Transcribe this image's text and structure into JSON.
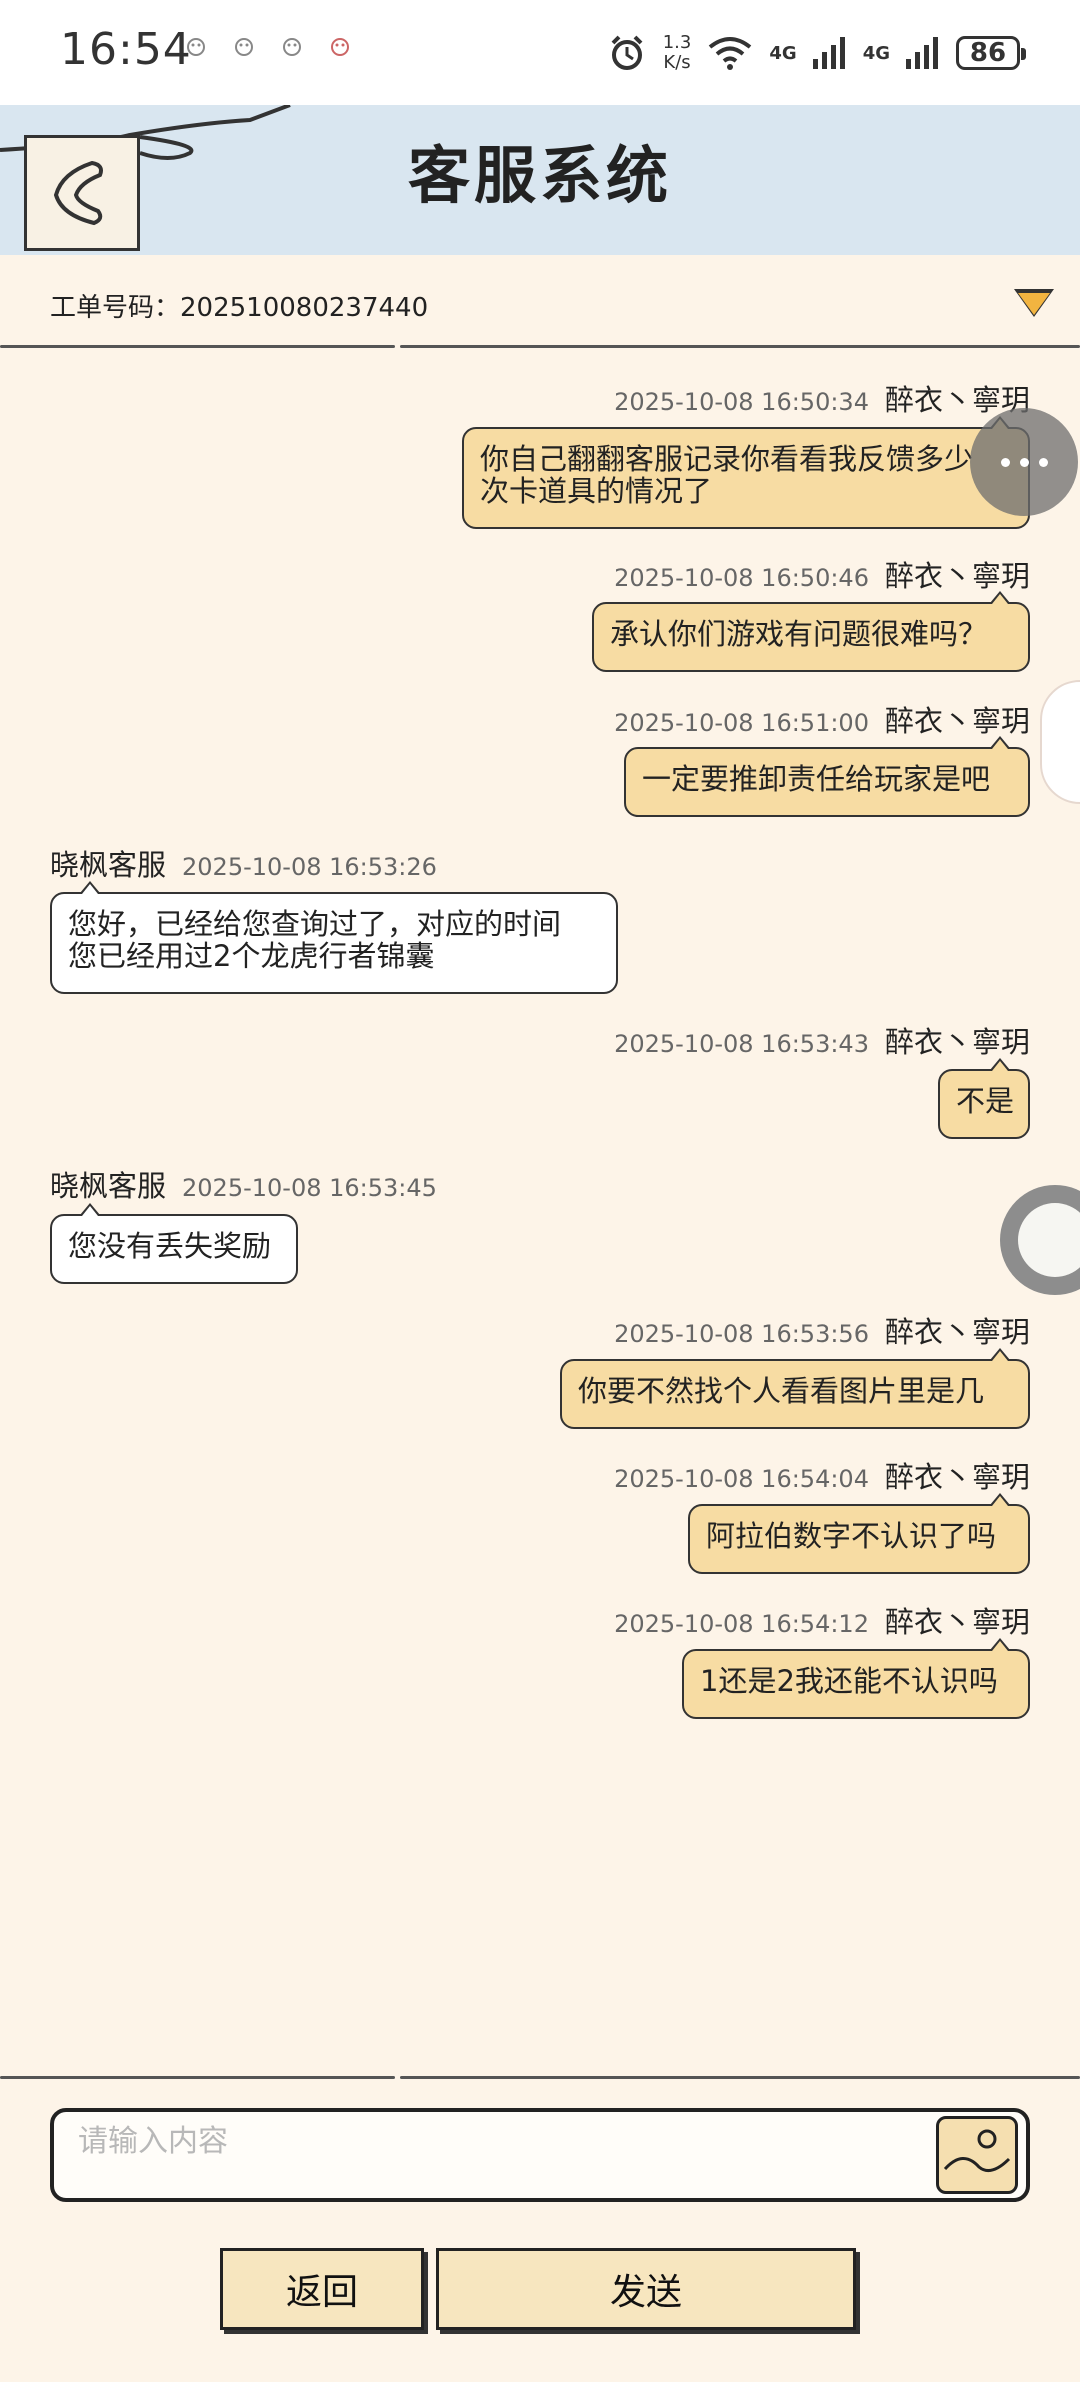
{
  "status_bar": {
    "time": "16:54",
    "net_speed_value": "1.3",
    "net_speed_unit": "K/s",
    "net1": "4G",
    "net2": "4G",
    "battery": "86"
  },
  "header": {
    "title": "客服系统"
  },
  "ticket": {
    "label": "工单号码：202510080237440"
  },
  "messages": [
    {
      "side": "me",
      "time": "2025-10-08 16:50:34",
      "name": "醉衣丶寧玥",
      "lines": [
        "你自己翻翻客服记录你看看我反馈多少",
        "次卡道具的情况了"
      ]
    },
    {
      "side": "me",
      "time": "2025-10-08 16:50:46",
      "name": "醉衣丶寧玥",
      "lines": [
        "承认你们游戏有问题很难吗？"
      ]
    },
    {
      "side": "me",
      "time": "2025-10-08 16:51:00",
      "name": "醉衣丶寧玥",
      "lines": [
        "一定要推卸责任给玩家是吧"
      ]
    },
    {
      "side": "cs",
      "time": "2025-10-08 16:53:26",
      "name": "晓枫客服",
      "lines": [
        "您好，已经给您查询过了，对应的时间",
        "您已经用过2个龙虎行者锦囊"
      ]
    },
    {
      "side": "me",
      "time": "2025-10-08 16:53:43",
      "name": "醉衣丶寧玥",
      "lines": [
        "不是"
      ]
    },
    {
      "side": "cs",
      "time": "2025-10-08 16:53:45",
      "name": "晓枫客服",
      "lines": [
        "您没有丢失奖励"
      ]
    },
    {
      "side": "me",
      "time": "2025-10-08 16:53:56",
      "name": "醉衣丶寧玥",
      "lines": [
        "你要不然找个人看看图片里是几"
      ]
    },
    {
      "side": "me",
      "time": "2025-10-08 16:54:04",
      "name": "醉衣丶寧玥",
      "lines": [
        "阿拉伯数字不认识了吗"
      ]
    },
    {
      "side": "me",
      "time": "2025-10-08 16:54:12",
      "name": "醉衣丶寧玥",
      "lines": [
        "1还是2我还能不认识吗"
      ]
    }
  ],
  "input": {
    "placeholder": "请输入内容",
    "value": ""
  },
  "buttons": {
    "back": "返回",
    "send": "发送"
  }
}
